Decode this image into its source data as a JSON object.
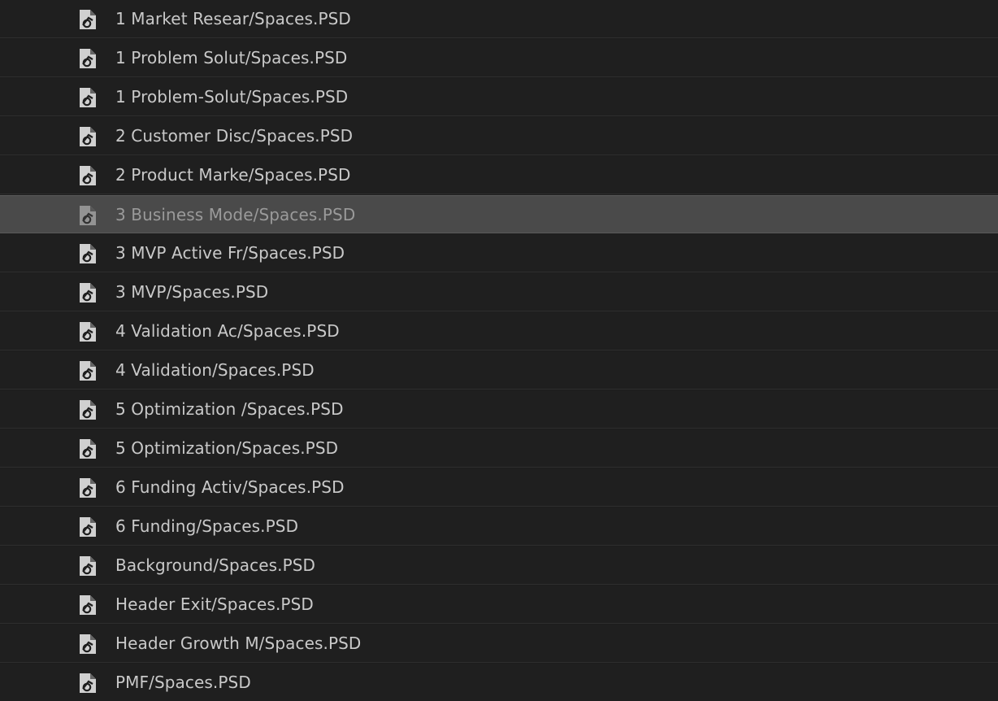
{
  "file_list": {
    "selected_index": 5,
    "icon": "psd-file-icon",
    "items": [
      {
        "label": "1 Market Resear/Spaces.PSD"
      },
      {
        "label": "1 Problem Solut/Spaces.PSD"
      },
      {
        "label": "1 Problem-Solut/Spaces.PSD"
      },
      {
        "label": "2 Customer Disc/Spaces.PSD"
      },
      {
        "label": "2 Product Marke/Spaces.PSD"
      },
      {
        "label": "3 Business Mode/Spaces.PSD"
      },
      {
        "label": "3 MVP Active Fr/Spaces.PSD"
      },
      {
        "label": "3 MVP/Spaces.PSD"
      },
      {
        "label": "4 Validation Ac/Spaces.PSD"
      },
      {
        "label": "4 Validation/Spaces.PSD"
      },
      {
        "label": "5 Optimization /Spaces.PSD"
      },
      {
        "label": "5 Optimization/Spaces.PSD"
      },
      {
        "label": "6 Funding Activ/Spaces.PSD"
      },
      {
        "label": "6 Funding/Spaces.PSD"
      },
      {
        "label": "Background/Spaces.PSD"
      },
      {
        "label": "Header Exit/Spaces.PSD"
      },
      {
        "label": "Header Growth M/Spaces.PSD"
      },
      {
        "label": "PMF/Spaces.PSD"
      }
    ]
  }
}
